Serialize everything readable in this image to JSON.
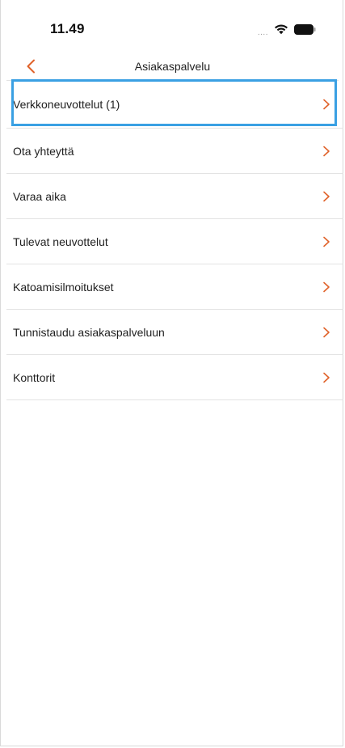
{
  "status_bar": {
    "time": "11.49",
    "signal_dots": "....",
    "wifi_icon": "wifi-icon",
    "battery_icon": "battery-icon"
  },
  "nav": {
    "title": "Asiakaspalvelu",
    "back_icon": "chevron-left-icon",
    "accent_color": "#e0622a"
  },
  "menu": {
    "highlight_color": "#3aa0e3",
    "items": [
      {
        "label": "Verkkoneuvottelut (1)",
        "highlighted": true
      },
      {
        "label": "Ota yhteyttä",
        "highlighted": false
      },
      {
        "label": "Varaa aika",
        "highlighted": false
      },
      {
        "label": "Tulevat neuvottelut",
        "highlighted": false
      },
      {
        "label": "Katoamisilmoitukset",
        "highlighted": false
      },
      {
        "label": "Tunnistaudu asiakaspalveluun",
        "highlighted": false
      },
      {
        "label": "Konttorit",
        "highlighted": false
      }
    ]
  }
}
